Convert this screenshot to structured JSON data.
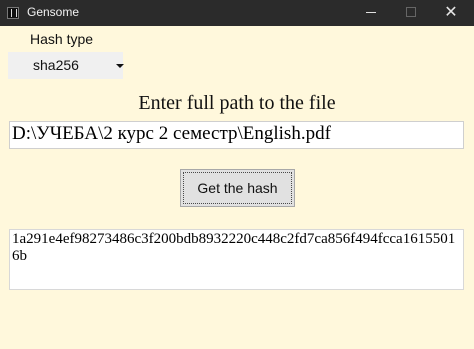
{
  "window": {
    "title": "Gensome",
    "icon": "gensome-app-icon",
    "close_glyph": "✕"
  },
  "hash_type": {
    "label": "Hash type",
    "selected": "sha256"
  },
  "prompt": "Enter full path to the file",
  "file_path": {
    "value": "D:\\УЧЕБА\\2 курс 2 семестр\\English.pdf"
  },
  "button": {
    "label": "Get the hash"
  },
  "result": {
    "hash": "1a291e4ef98273486c3f200bdb8932220c448c2fd7ca856f494fcca16155016b"
  },
  "colors": {
    "background": "#fff8dc",
    "titlebar": "#2b2b2b"
  }
}
